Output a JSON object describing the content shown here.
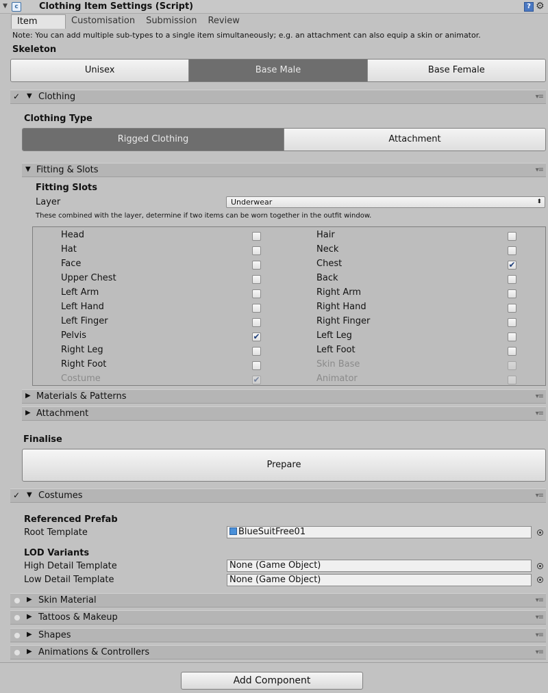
{
  "header": {
    "title": "Clothing Item Settings (Script)"
  },
  "tabs": [
    "Item",
    "Customisation",
    "Submission",
    "Review"
  ],
  "note": "Note: You can add multiple sub-types to a single item simultaneously; e.g. an attachment can also equip a skin or animator.",
  "skeleton": {
    "label": "Skeleton",
    "options": [
      "Unisex",
      "Base Male",
      "Base Female"
    ],
    "selected": "Base Male"
  },
  "clothing": {
    "label": "Clothing",
    "type_label": "Clothing Type",
    "type_options": [
      "Rigged Clothing",
      "Attachment"
    ],
    "type_selected": "Rigged Clothing",
    "fitting": {
      "label": "Fitting & Slots",
      "heading": "Fitting Slots",
      "layer_label": "Layer",
      "layer_value": "Underwear",
      "hint": "These combined with the layer, determine if two items can be worn together in the outfit window.",
      "left_slots": [
        {
          "name": "Head",
          "checked": false
        },
        {
          "name": "Hat",
          "checked": false
        },
        {
          "name": "Face",
          "checked": false
        },
        {
          "name": "Upper Chest",
          "checked": false
        },
        {
          "name": "Left Arm",
          "checked": false
        },
        {
          "name": "Left Hand",
          "checked": false
        },
        {
          "name": "Left Finger",
          "checked": false
        },
        {
          "name": "Pelvis",
          "checked": true
        },
        {
          "name": "Right Leg",
          "checked": false
        },
        {
          "name": "Right Foot",
          "checked": false
        },
        {
          "name": "Costume",
          "checked": true,
          "disabled": true
        }
      ],
      "right_slots": [
        {
          "name": "Hair",
          "checked": false
        },
        {
          "name": "Neck",
          "checked": false
        },
        {
          "name": "Chest",
          "checked": true
        },
        {
          "name": "Back",
          "checked": false
        },
        {
          "name": "Right Arm",
          "checked": false
        },
        {
          "name": "Right Hand",
          "checked": false
        },
        {
          "name": "Right Finger",
          "checked": false
        },
        {
          "name": "Left Leg",
          "checked": false
        },
        {
          "name": "Left Foot",
          "checked": false
        },
        {
          "name": "Skin Base",
          "checked": false,
          "disabled": true
        },
        {
          "name": "Animator",
          "checked": false,
          "disabled": true
        }
      ]
    },
    "materials_label": "Materials & Patterns",
    "attachment_label": "Attachment",
    "finalise_label": "Finalise",
    "prepare_label": "Prepare"
  },
  "costumes": {
    "label": "Costumes",
    "referenced_prefab": "Referenced Prefab",
    "root_template_label": "Root Template",
    "root_template_value": "BlueSuitFree01",
    "lod_variants": "LOD Variants",
    "high_detail_label": "High Detail Template",
    "high_detail_value": "None (Game Object)",
    "low_detail_label": "Low Detail Template",
    "low_detail_value": "None (Game Object)"
  },
  "sections": [
    "Skin Material",
    "Tattoos & Makeup",
    "Shapes",
    "Animations & Controllers"
  ],
  "add_component": "Add Component"
}
